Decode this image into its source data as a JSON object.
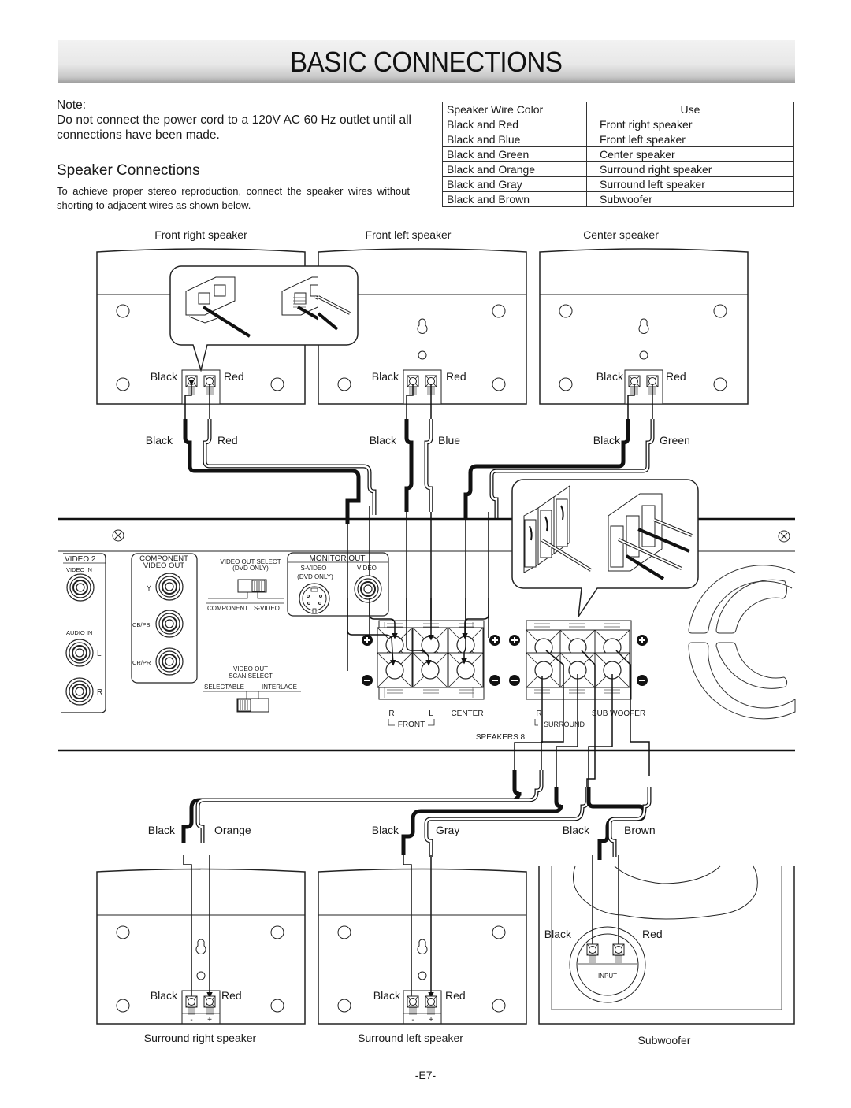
{
  "page": {
    "title": "BASIC CONNECTIONS",
    "page_number": "-E7-"
  },
  "note": {
    "label": "Note:",
    "text": "Do not connect the power cord to a 120V AC 60 Hz outlet until all connections have been made."
  },
  "speaker_connections": {
    "heading": "Speaker Connections",
    "description": "To achieve proper stereo reproduction, connect the speaker wires without shorting to adjacent wires as shown below."
  },
  "wire_table": {
    "headers": [
      "Speaker Wire Color",
      "Use"
    ],
    "rows": [
      [
        "Black and Red",
        "Front right speaker"
      ],
      [
        "Black and Blue",
        "Front left speaker"
      ],
      [
        "Black and Green",
        "Center speaker"
      ],
      [
        "Black and Orange",
        "Surround right speaker"
      ],
      [
        "Black and Gray",
        "Surround left speaker"
      ],
      [
        "Black and Brown",
        "Subwoofer"
      ]
    ]
  },
  "speakers": {
    "front_right": {
      "name": "Front right speaker",
      "term_neg": "Black",
      "term_pos": "Red",
      "wire_neg": "Black",
      "wire_pos": "Red"
    },
    "front_left": {
      "name": "Front left speaker",
      "term_neg": "Black",
      "term_pos": "Red",
      "wire_neg": "Black",
      "wire_pos": "Blue"
    },
    "center": {
      "name": "Center speaker",
      "term_neg": "Black",
      "term_pos": "Red",
      "wire_neg": "Black",
      "wire_pos": "Green"
    },
    "surround_right": {
      "name": "Surround right speaker",
      "term_neg": "Black",
      "term_pos": "Red",
      "wire_neg": "Black",
      "wire_pos": "Orange",
      "pol_neg": "-",
      "pol_pos": "+"
    },
    "surround_left": {
      "name": "Surround left speaker",
      "term_neg": "Black",
      "term_pos": "Red",
      "wire_neg": "Black",
      "wire_pos": "Gray",
      "pol_neg": "-",
      "pol_pos": "+"
    },
    "subwoofer": {
      "name": "Subwoofer",
      "term_neg": "Black",
      "term_pos": "Red",
      "wire_neg": "Black",
      "wire_pos": "Brown",
      "input_label": "INPUT"
    }
  },
  "receiver_panel": {
    "video2": {
      "title": "VIDEO 2",
      "video_in": "VIDEO IN",
      "audio_in": "AUDIO IN",
      "left": "L",
      "right": "R"
    },
    "component": {
      "title_line1": "COMPONENT",
      "title_line2": "VIDEO OUT",
      "y": "Y",
      "cb": "CB/PB",
      "cr": "CR/PR"
    },
    "video_out_select": {
      "line1": "VIDEO OUT SELECT",
      "line2": "(DVD ONLY)",
      "opt_a": "COMPONENT",
      "opt_b": "S-VIDEO"
    },
    "scan_select": {
      "line1": "VIDEO OUT",
      "line2": "SCAN SELECT",
      "opt_a": "SELECTABLE",
      "opt_b": "INTERLACE"
    },
    "monitor_out": {
      "title": "MONITOR OUT",
      "svideo": "S-VIDEO",
      "svideo_note": "(DVD ONLY)",
      "video": "VIDEO"
    },
    "speaker_terminals": {
      "front_r": "R",
      "front_l": "L",
      "front_group": "FRONT",
      "center": "CENTER",
      "surround_r": "R",
      "surround_group": "SURROUND",
      "subwoofer": "SUB WOOFER",
      "label": "SPEAKERS 8"
    }
  }
}
